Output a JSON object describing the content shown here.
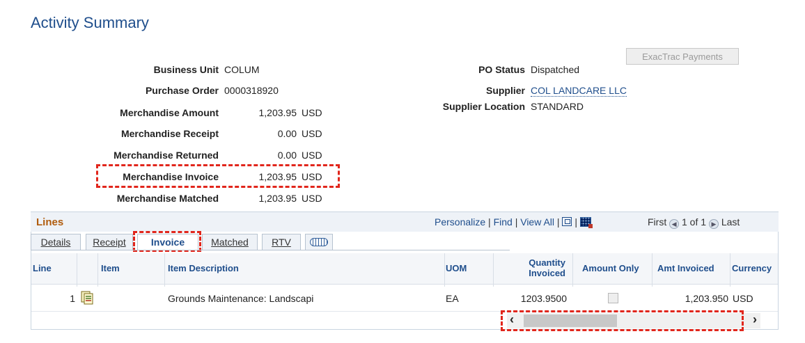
{
  "page_title": "Activity Summary",
  "buttons": {
    "exactrac": "ExacTrac Payments"
  },
  "left_fields": [
    {
      "label": "Business Unit",
      "value": "COLUM"
    },
    {
      "label": "Purchase Order",
      "value": "0000318920"
    }
  ],
  "amounts": [
    {
      "label": "Merchandise Amount",
      "value": "1,203.95",
      "currency": "USD"
    },
    {
      "label": "Merchandise Receipt",
      "value": "0.00",
      "currency": "USD"
    },
    {
      "label": "Merchandise Returned",
      "value": "0.00",
      "currency": "USD"
    },
    {
      "label": "Merchandise Invoice",
      "value": "1,203.95",
      "currency": "USD"
    },
    {
      "label": "Merchandise Matched",
      "value": "1,203.95",
      "currency": "USD"
    }
  ],
  "right_fields": [
    {
      "label": "PO Status",
      "value": "Dispatched"
    },
    {
      "label": "Supplier",
      "value": "COL LANDCARE LLC"
    },
    {
      "label": "Supplier Location",
      "value": "STANDARD"
    }
  ],
  "grid": {
    "title": "Lines",
    "nav": {
      "personalize": "Personalize",
      "find": "Find",
      "view_all": "View All",
      "sep": "|",
      "first": "First",
      "range": "1 of 1",
      "last": "Last"
    },
    "tabs": [
      "Details",
      "Receipt",
      "Invoice",
      "Matched",
      "RTV"
    ],
    "active_tab": "Invoice",
    "columns": [
      "Line",
      "Item",
      "Item Description",
      "UOM",
      "Quantity Invoiced",
      "Amount Only",
      "Amt Invoiced",
      "Currency"
    ],
    "rows": [
      {
        "line": "1",
        "item": "",
        "description": "Grounds Maintenance: Landscapi",
        "uom": "EA",
        "quantity_invoiced": "1203.9500",
        "amount_only": false,
        "amt_invoiced": "1,203.950",
        "currency": "USD"
      }
    ]
  },
  "colors": {
    "accent": "#1f4e8c",
    "grid_title": "#b05c0d",
    "highlight": "#e1261c"
  }
}
